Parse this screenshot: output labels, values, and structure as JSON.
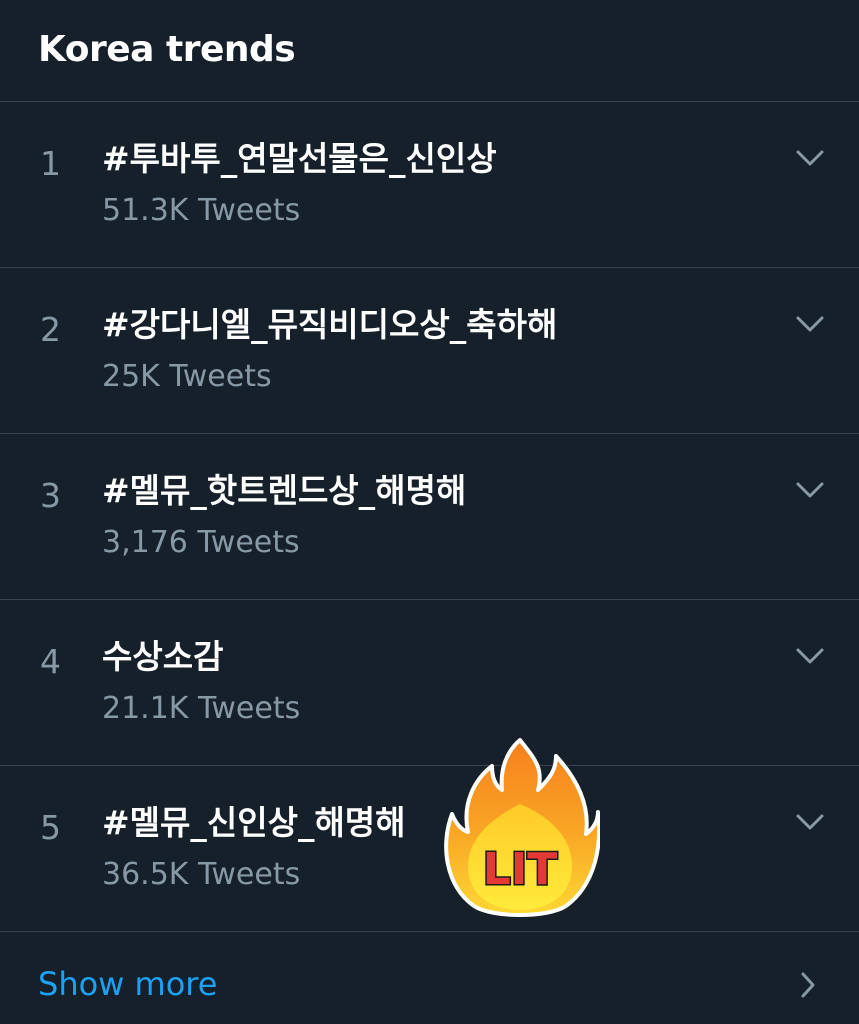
{
  "header": {
    "title": "Korea trends"
  },
  "trends": [
    {
      "rank": "1",
      "name": "#투바투_연말선물은_신인상",
      "count": "51.3K Tweets"
    },
    {
      "rank": "2",
      "name": "#강다니엘_뮤직비디오상_축하해",
      "count": "25K Tweets"
    },
    {
      "rank": "3",
      "name": "#멜뮤_핫트렌드상_해명해",
      "count": "3,176 Tweets"
    },
    {
      "rank": "4",
      "name": "수상소감",
      "count": "21.1K Tweets"
    },
    {
      "rank": "5",
      "name": "#멜뮤_신인상_해명해",
      "count": "36.5K Tweets"
    }
  ],
  "footer": {
    "show_more_label": "Show more"
  },
  "sticker": {
    "text": "LIT",
    "icon": "fire-lit-sticker"
  },
  "colors": {
    "background": "#15202b",
    "divider": "#38444d",
    "secondary_text": "#8899a6",
    "accent": "#1da1f2"
  }
}
